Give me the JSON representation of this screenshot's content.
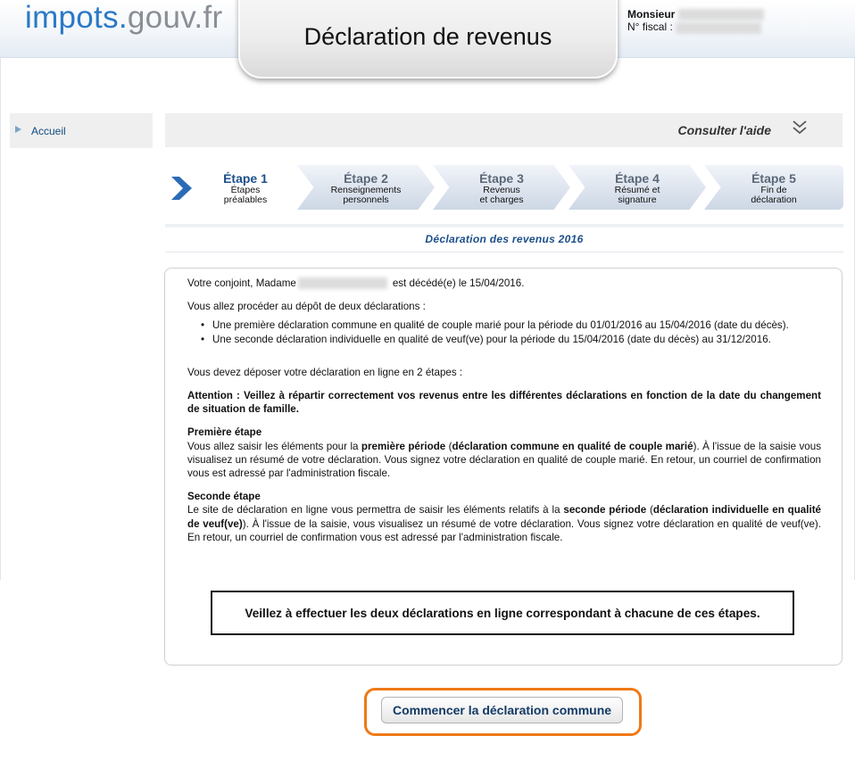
{
  "header": {
    "logo_part1": "impots.",
    "logo_part2": "gouv.fr",
    "page_title": "Déclaration de revenus",
    "user_label": "Monsieur",
    "fiscal_label": "N° fiscal :"
  },
  "sidebar": {
    "items": [
      {
        "label": "Accueil"
      }
    ]
  },
  "helpbar": {
    "label": "Consulter l'aide"
  },
  "steps": [
    {
      "title": "Étape 1",
      "line1": "Étapes",
      "line2": "préalables",
      "active": true
    },
    {
      "title": "Étape 2",
      "line1": "Renseignements",
      "line2": "personnels",
      "active": false
    },
    {
      "title": "Étape 3",
      "line1": "Revenus",
      "line2": "et charges",
      "active": false
    },
    {
      "title": "Étape 4",
      "line1": "Résumé et",
      "line2": "signature",
      "active": false
    },
    {
      "title": "Étape 5",
      "line1": "Fin de",
      "line2": "déclaration",
      "active": false
    }
  ],
  "section_title": "Déclaration des revenus 2016",
  "content": {
    "spouse_prefix": "Votre conjoint, Madame",
    "spouse_suffix": "est décédé(e) le 15/04/2016.",
    "intro": "Vous allez procéder au dépôt de deux déclarations :",
    "bullets": [
      "Une première déclaration commune en qualité de couple marié pour la période du 01/01/2016 au 15/04/2016 (date du décès).",
      "Une seconde déclaration individuelle en qualité de veuf(ve) pour la période du 15/04/2016 (date du décès) au 31/12/2016."
    ],
    "steps_intro": "Vous devez déposer votre déclaration en ligne en 2 étapes :",
    "attention": "Attention  : Veillez à répartir correctement vos revenus entre les différentes déclarations en fonction de la date du changement de situation de famille.",
    "first_title": "Première étape",
    "first_a": "Vous allez saisir les éléments pour la ",
    "first_b": "première période",
    "first_c": " (",
    "first_d": "déclaration commune en qualité de couple marié",
    "first_e": "). À l'issue de la saisie vous visualisez un résumé de votre déclaration. Vous signez votre déclaration en qualité de couple marié. En retour, un courriel de confirmation vous est adressé par l'administration fiscale.",
    "second_title": "Seconde étape",
    "second_a": "Le site de déclaration en ligne vous permettra de saisir les éléments relatifs à la ",
    "second_b": "seconde période",
    "second_c": " (",
    "second_d": "déclaration individuelle en qualité de veuf(ve)",
    "second_e": "). À l'issue de la saisie, vous visualisez un résumé de votre déclaration. Vous signez votre déclaration en qualité de veuf(ve). En retour, un courriel de confirmation vous est adressé par l'administration fiscale."
  },
  "notice": "Veillez à effectuer les deux déclarations en ligne correspondant à chacune de ces étapes.",
  "cta_label": "Commencer la déclaration commune",
  "colors": {
    "brand_blue": "#2a79c6",
    "brand_grey": "#8a8f96",
    "step_blue": "#1c4f8a",
    "highlight_orange": "#ee7a16"
  }
}
